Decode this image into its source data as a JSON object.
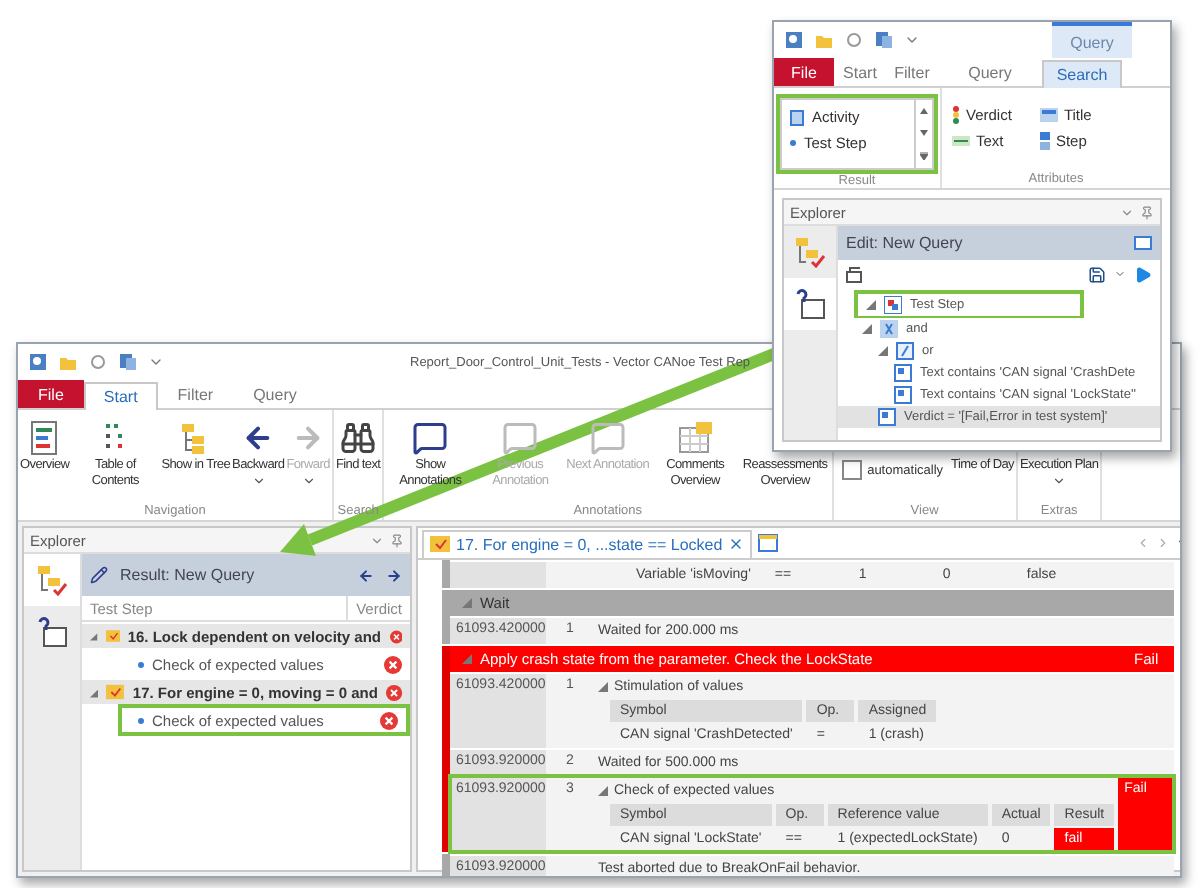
{
  "main_window": {
    "title": "Report_Door_Control_Unit_Tests - Vector CANoe Test Rep",
    "tabs": [
      {
        "label": "File",
        "kind": "file",
        "selected": false
      },
      {
        "label": "Start",
        "kind": "tab",
        "selected": true
      },
      {
        "label": "Filter",
        "kind": "tab",
        "selected": false
      },
      {
        "label": "Query",
        "kind": "tab",
        "selected": false
      }
    ],
    "ribbon_groups": [
      {
        "label": "Navigation",
        "items": [
          {
            "label": "Overview",
            "kind": "button",
            "disabled": false
          },
          {
            "label": "Table of Contents",
            "kind": "button",
            "disabled": false
          },
          {
            "label": "Show in Tree",
            "kind": "button",
            "disabled": false
          },
          {
            "label": "Backward",
            "kind": "dropdown",
            "disabled": false
          },
          {
            "label": "Forward",
            "kind": "dropdown",
            "disabled": true
          }
        ]
      },
      {
        "label": "Search",
        "items": [
          {
            "label": "Find text",
            "kind": "button",
            "disabled": false
          }
        ]
      },
      {
        "label": "Annotations",
        "items": [
          {
            "label": "Show Annotations",
            "kind": "button",
            "disabled": false
          },
          {
            "label": "Previous Annotation",
            "kind": "button",
            "disabled": true
          },
          {
            "label": "Next Annotation",
            "kind": "button",
            "disabled": true
          },
          {
            "label": "Comments Overview",
            "kind": "button",
            "disabled": false
          },
          {
            "label": "Reassessments Overview",
            "kind": "button",
            "disabled": false
          }
        ]
      },
      {
        "label": "View",
        "items": [
          {
            "label": "automatically",
            "kind": "checkbox",
            "checked": false
          },
          {
            "label": "Time of Day",
            "kind": "button",
            "disabled": false
          }
        ]
      },
      {
        "label": "Extras",
        "items": [
          {
            "label": "Execution Plan",
            "kind": "dropdown",
            "disabled": false
          }
        ]
      }
    ],
    "explorer": {
      "title": "Explorer",
      "result_title": "Result: New Query",
      "columns": [
        "Test Step",
        "Verdict"
      ],
      "tree": [
        {
          "label": "16. Lock dependent on velocity and",
          "expanded": true,
          "failed": true,
          "children": [
            {
              "label": "Check of expected values",
              "failed": true,
              "highlighted": false
            }
          ]
        },
        {
          "label": "17. For engine = 0, moving = 0 and",
          "expanded": true,
          "failed": true,
          "children": [
            {
              "label": "Check of expected values",
              "failed": true,
              "highlighted": true
            }
          ]
        }
      ]
    },
    "document": {
      "tab": "17. For engine = 0, ...state == Locked",
      "sections": [
        {
          "steps": [
            {
              "table": {
                "rows": [
                  {
                    "cells": [
                      "Variable 'isMoving'",
                      "==",
                      "1",
                      "0",
                      "false"
                    ],
                    "failed": false
                  }
                ]
              }
            }
          ]
        },
        {
          "label": "Wait",
          "failed": false,
          "steps": [
            {
              "time": "61093.420000",
              "num": "1",
              "text": "Waited for 200.000 ms"
            }
          ]
        },
        {
          "label": "Apply crash state from the parameter. Check the LockState",
          "failed": true,
          "verdict": "Fail",
          "steps": [
            {
              "time": "61093.420000",
              "num": "1",
              "text": "Stimulation of values",
              "expanded": true,
              "table": {
                "columns": [
                  "Symbol",
                  "Op.",
                  "Assigned"
                ],
                "rows": [
                  {
                    "cells": [
                      "CAN signal 'CrashDetected'",
                      "=",
                      "1 (crash)"
                    ],
                    "failed": false
                  }
                ]
              }
            },
            {
              "time": "61093.920000",
              "num": "2",
              "text": "Waited for 500.000 ms"
            },
            {
              "time": "61093.920000",
              "num": "3",
              "text": "Check of expected values",
              "expanded": true,
              "failed": true,
              "verdict": "Fail",
              "highlighted": true,
              "table": {
                "columns": [
                  "Symbol",
                  "Op.",
                  "Reference value",
                  "Actual",
                  "Result"
                ],
                "rows": [
                  {
                    "cells": [
                      "CAN signal 'LockState'",
                      "==",
                      "1 (expectedLockState)",
                      "0",
                      "fail"
                    ],
                    "failed": true
                  }
                ]
              }
            }
          ]
        },
        {
          "steps": [
            {
              "time": "61093.920000",
              "text": "Test aborted due to BreakOnFail behavior."
            }
          ]
        }
      ]
    }
  },
  "query_window": {
    "context_label": "Query",
    "tabs": [
      {
        "label": "File",
        "kind": "file",
        "selected": false
      },
      {
        "label": "Start",
        "kind": "tab",
        "selected": false
      },
      {
        "label": "Filter",
        "kind": "tab",
        "selected": false
      },
      {
        "label": "Query",
        "kind": "tab",
        "selected": false
      },
      {
        "label": "Search",
        "kind": "contextual",
        "selected": true
      }
    ],
    "result_group": {
      "label": "Result",
      "items": [
        "Activity",
        "Test Step"
      ],
      "highlighted": true
    },
    "attributes_group": {
      "label": "Attributes",
      "items": [
        "Verdict",
        "Title",
        "Text",
        "Step"
      ]
    },
    "explorer": {
      "title": "Explorer",
      "edit_title": "Edit: New Query",
      "tree": [
        {
          "label": "Test Step",
          "kind": "step",
          "highlighted": true,
          "selected": false,
          "children": [
            {
              "label": "and",
              "kind": "and",
              "highlighted": false,
              "selected": false,
              "children": [
                {
                  "label": "or",
                  "kind": "or",
                  "highlighted": false,
                  "selected": false,
                  "children": [
                    {
                      "label": "Text contains 'CAN signal 'CrashDete",
                      "kind": "text",
                      "highlighted": false,
                      "selected": false
                    },
                    {
                      "label": "Text contains 'CAN signal 'LockState''",
                      "kind": "text",
                      "highlighted": false,
                      "selected": false
                    }
                  ]
                },
                {
                  "label": "Verdict = '[Fail,Error in test system]'",
                  "kind": "verdict",
                  "highlighted": false,
                  "selected": true
                }
              ]
            }
          ]
        }
      ]
    }
  }
}
